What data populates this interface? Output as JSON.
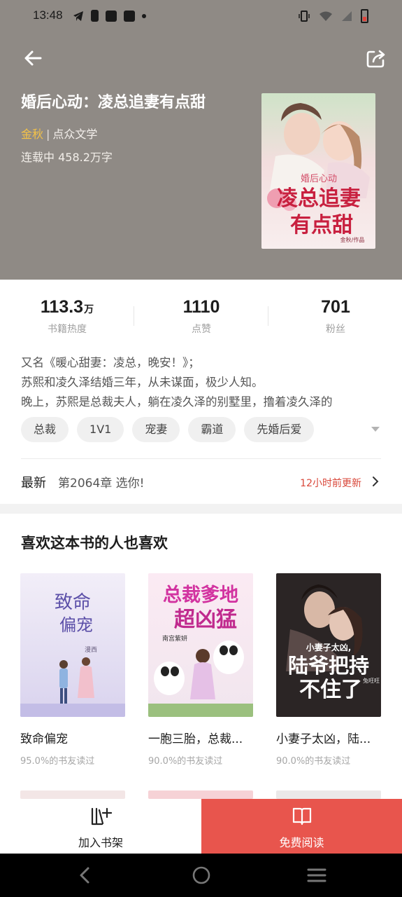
{
  "status_bar": {
    "time": "13:48"
  },
  "book": {
    "title": "婚后心动：凌总追妻有点甜",
    "author": "金秋",
    "separator": "|",
    "publisher": "点众文学",
    "status_words": "连载中 458.2万字",
    "cover_title_lines": [
      "婚后心动",
      "凌总追妻",
      "有点甜"
    ],
    "cover_credit": "金秋/作品"
  },
  "stats": [
    {
      "value": "113.3",
      "unit": "万",
      "label": "书籍热度"
    },
    {
      "value": "1110",
      "unit": "",
      "label": "点赞"
    },
    {
      "value": "701",
      "unit": "",
      "label": "粉丝"
    }
  ],
  "description": [
    "又名《暖心甜妻：凌总，晚安！》；",
    "苏熙和凌久泽结婚三年，从未谋面，极少人知。",
    "晚上，苏熙是总裁夫人，躺在凌久泽的别墅里，撸着凌久泽的"
  ],
  "tags": [
    "总裁",
    "1V1",
    "宠妻",
    "霸道",
    "先婚后爱"
  ],
  "latest": {
    "label": "最新",
    "chapter": "第2064章 选你!",
    "updated": "12小时前更新"
  },
  "recommendations": {
    "title": "喜欢这本书的人也喜欢",
    "items": [
      {
        "name": "致命偏宠",
        "sub": "95.0%的书友读过",
        "cover_text": "致命偏宠",
        "cover_credit": "漫西"
      },
      {
        "name": "一胞三胎，总裁...",
        "sub": "90.0%的书友读过",
        "cover_text": "总裁爹地超凶猛",
        "cover_credit": "南宫紫妍"
      },
      {
        "name": "小妻子太凶，陆...",
        "sub": "90.0%的书友读过",
        "cover_text": "陆爷把持不住了",
        "cover_subtitle": "小妻子太凶,",
        "cover_credit": "兔旺旺"
      }
    ]
  },
  "actions": {
    "shelf_label": "加入书架",
    "read_label": "免费阅读"
  },
  "colors": {
    "header_bg": "#8f8a85",
    "accent_red": "#e8554d",
    "author_yellow": "#f4c247",
    "update_red": "#d9473a"
  },
  "icons": {
    "back": "arrow-left-icon",
    "share": "share-icon",
    "latest_arrow": "chevron-right-icon",
    "shelf": "bookshelf-add-icon",
    "read": "open-book-icon"
  }
}
